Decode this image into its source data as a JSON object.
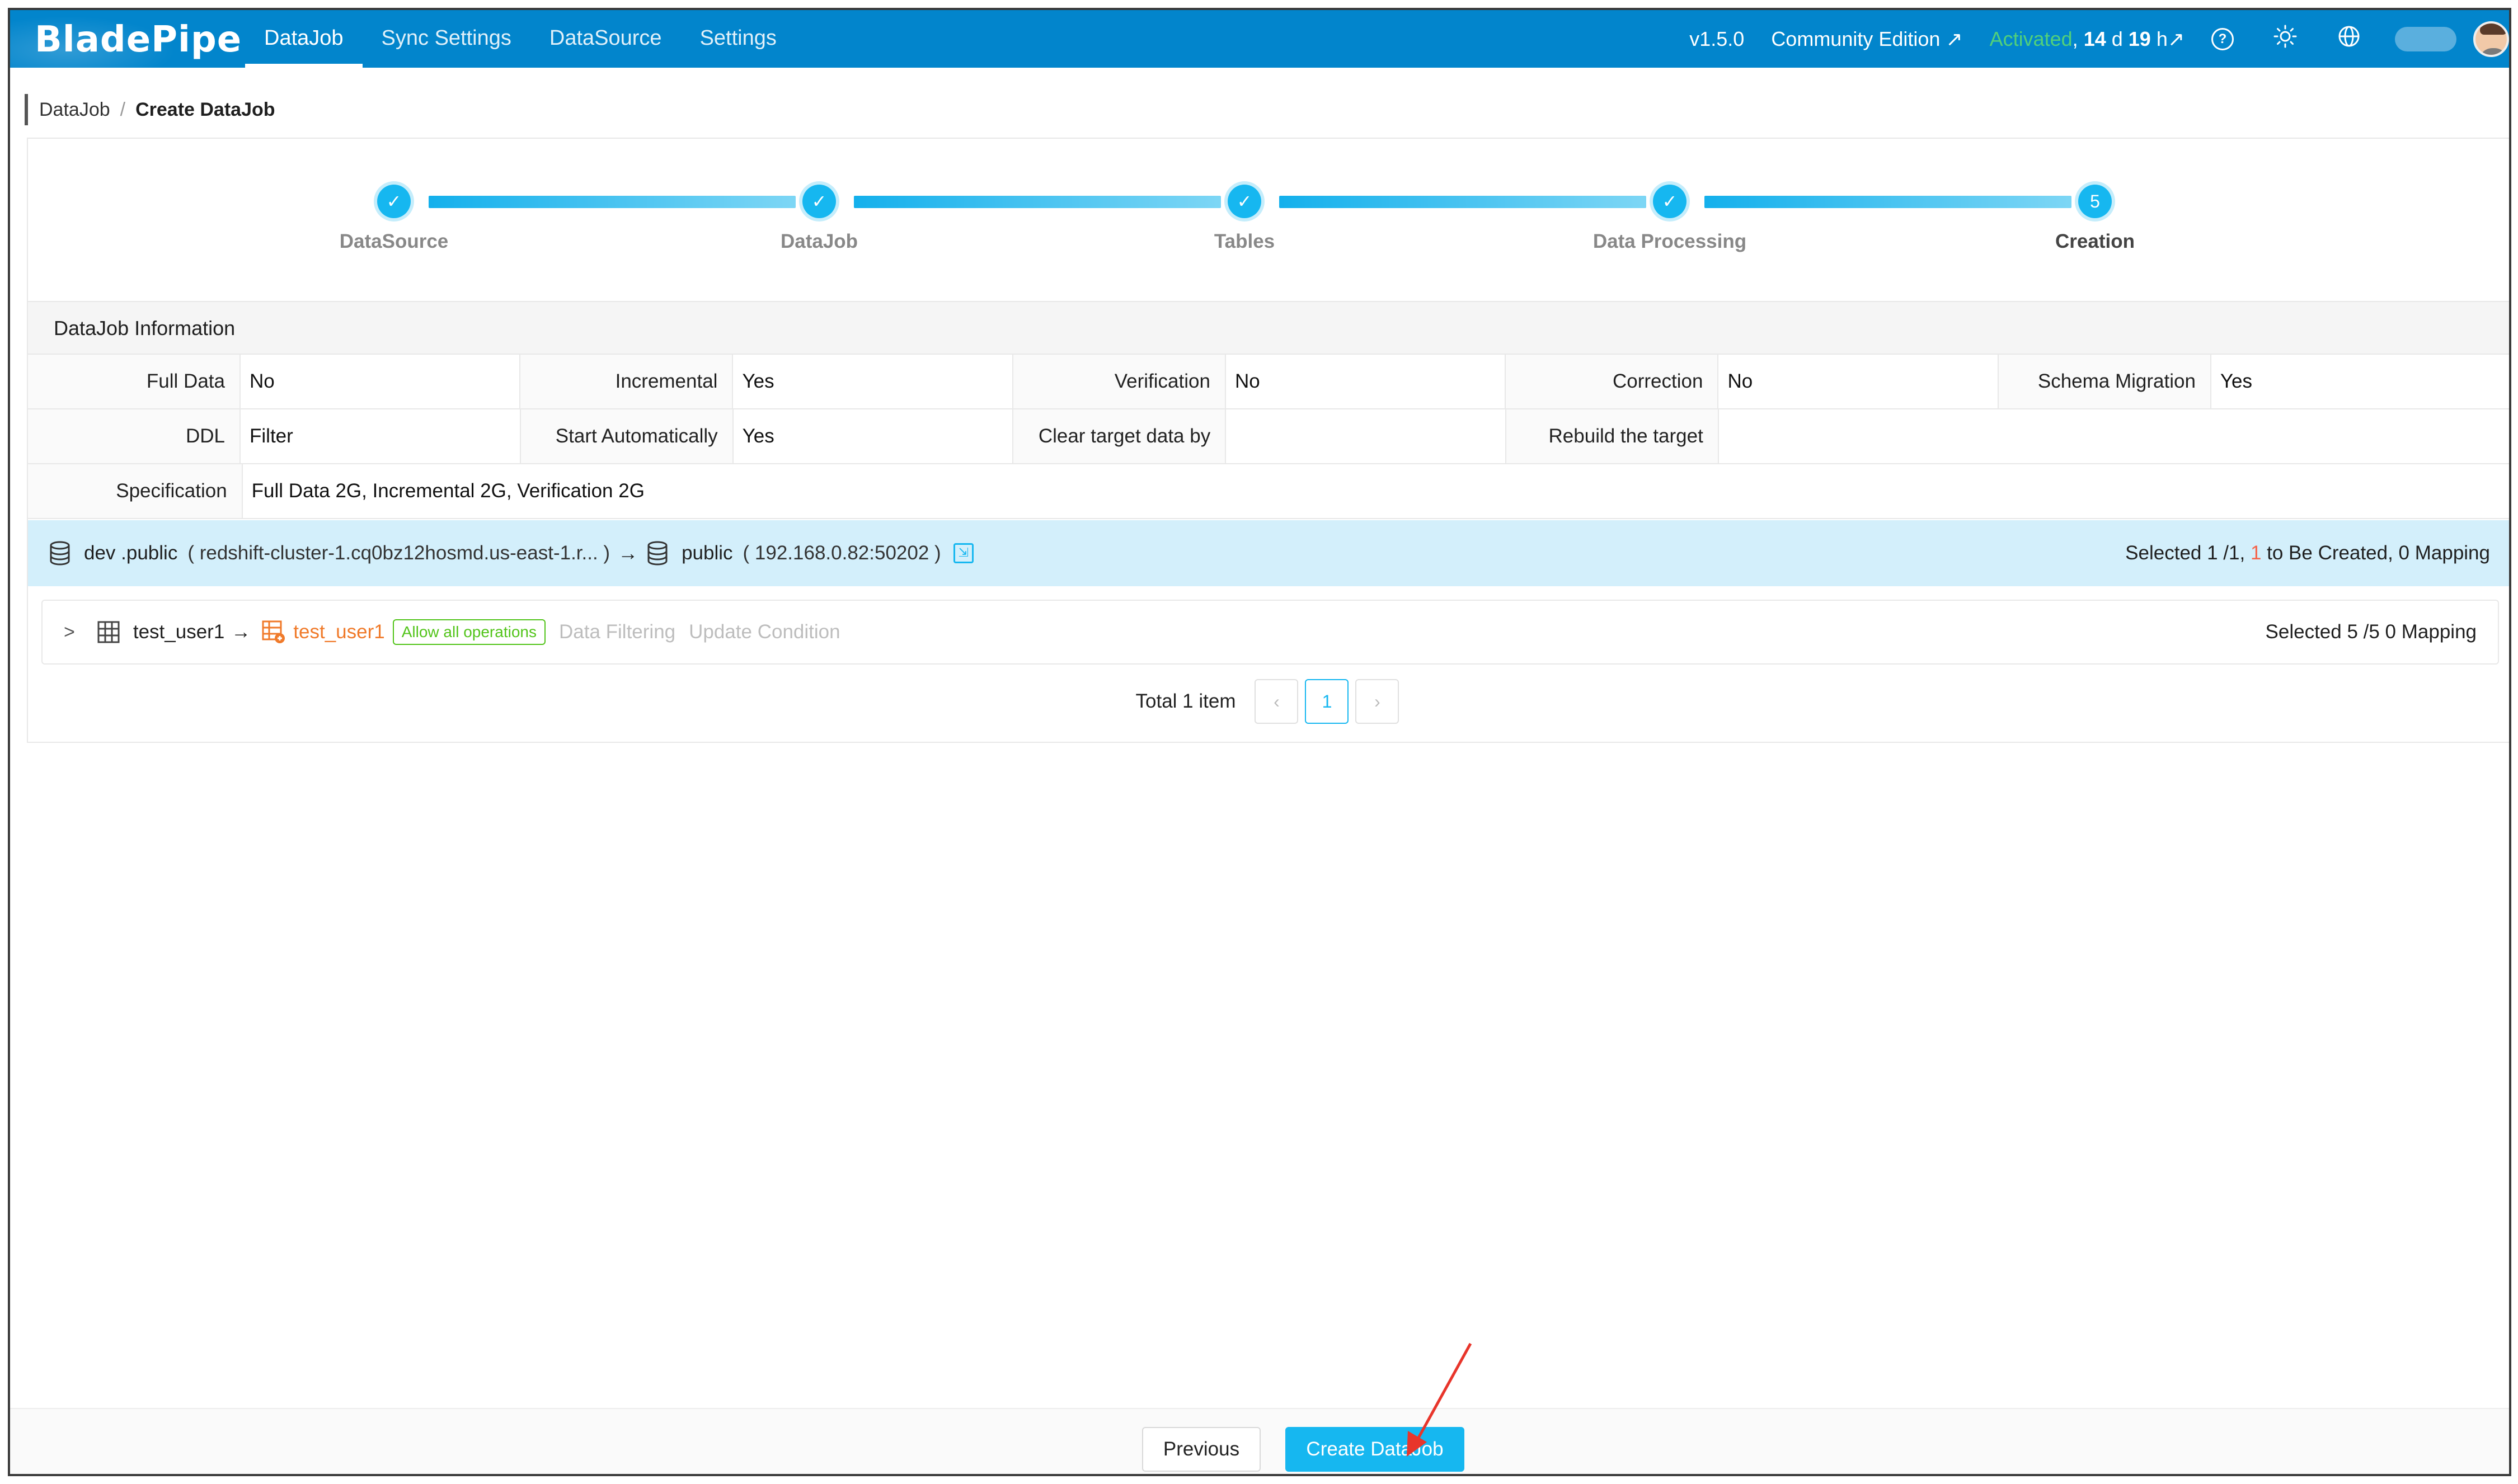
{
  "app": {
    "logo": "BladePipe",
    "nav": [
      "DataJob",
      "Sync Settings",
      "DataSource",
      "Settings"
    ],
    "version": "v1.5.0",
    "edition": "Community Edition ↗",
    "activated": "Activated",
    "license_prefix": ", ",
    "license_days": "14",
    "license_d": " d ",
    "license_hours": "19",
    "license_h": " h↗"
  },
  "breadcrumb": {
    "parent": "DataJob",
    "separator": "/",
    "current": "Create DataJob"
  },
  "steps": [
    {
      "label": "DataSource",
      "state": "done"
    },
    {
      "label": "DataJob",
      "state": "done"
    },
    {
      "label": "Tables",
      "state": "done"
    },
    {
      "label": "Data Processing",
      "state": "done"
    },
    {
      "label": "Creation",
      "state": "current",
      "number": "5"
    }
  ],
  "info": {
    "title": "DataJob Information",
    "row1": [
      {
        "label": "Full Data",
        "value": "No"
      },
      {
        "label": "Incremental",
        "value": "Yes"
      },
      {
        "label": "Verification",
        "value": "No"
      },
      {
        "label": "Correction",
        "value": "No"
      },
      {
        "label": "Schema Migration",
        "value": "Yes"
      }
    ],
    "row2": [
      {
        "label": "DDL",
        "value": "Filter"
      },
      {
        "label": "Start Automatically",
        "value": "Yes"
      },
      {
        "label": "Clear target data by",
        "value": ""
      },
      {
        "label": "Rebuild the target",
        "value": ""
      }
    ],
    "spec_label": "Specification",
    "spec_value": "Full Data 2G, Incremental 2G, Verification 2G"
  },
  "mapping": {
    "source_schema": "dev .public",
    "source_host": "( redshift-cluster-1.cq0bz12hosmd.us-east-1.r... )",
    "arrow": "→",
    "target_schema": "public",
    "target_host": "( 192.168.0.82:50202 )",
    "summary_prefix": "Selected 1 /1, ",
    "summary_red": "1",
    "summary_suffix": " to Be Created, 0 Mapping"
  },
  "table_row": {
    "source_table": "test_user1",
    "arrow": "→",
    "target_table": "test_user1",
    "tag": "Allow all operations",
    "link_filter": "Data Filtering",
    "link_update": "Update Condition",
    "summary": "Selected 5 /5 0 Mapping"
  },
  "pagination": {
    "total": "Total 1 item",
    "page": "1",
    "prev": "‹",
    "next": "›"
  },
  "footer": {
    "previous": "Previous",
    "create": "Create DataJob"
  },
  "colors": {
    "topbar": "#0285cc",
    "accent": "#16b7f0",
    "activated": "#52d07a",
    "mapping_bg": "#d3effb",
    "new_table": "#f07a2a",
    "annotation": "#e8352b"
  }
}
